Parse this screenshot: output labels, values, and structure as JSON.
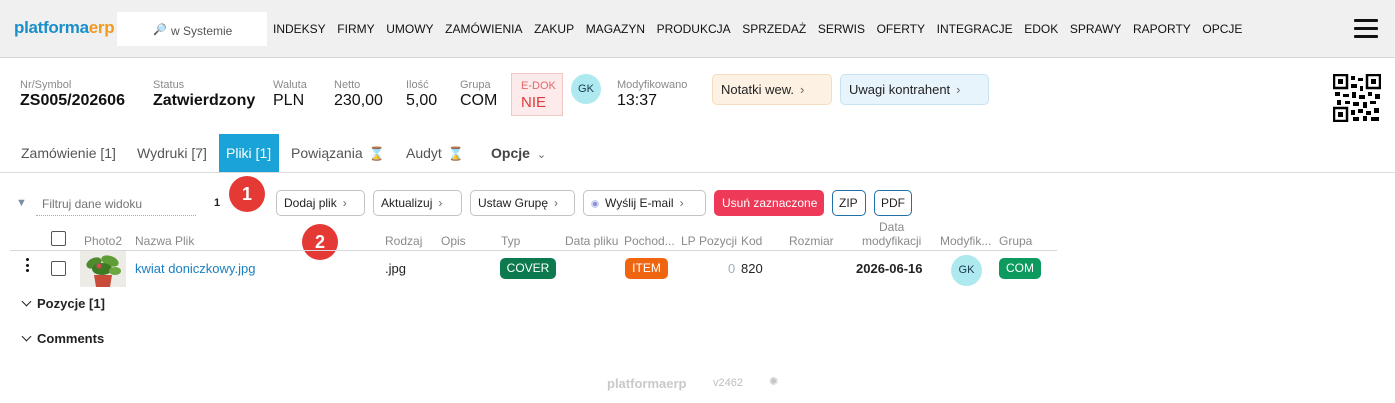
{
  "app": {
    "logo_part1": "platforma",
    "logo_part2": "erp"
  },
  "search": {
    "placeholder": "w Systemie"
  },
  "nav": [
    "INDEKSY",
    "FIRMY",
    "UMOWY",
    "ZAMÓWIENIA",
    "ZAKUP",
    "MAGAZYN",
    "PRODUKCJA",
    "SPRZEDAŻ",
    "SERWIS",
    "OFERTY",
    "INTEGRACJE",
    "EDOK",
    "SPRAWY",
    "RAPORTY",
    "OPCJE"
  ],
  "header": {
    "nr_label": "Nr/Symbol",
    "nr_value": "ZS005/202606",
    "status_label": "Status",
    "status_value": "Zatwierdzony",
    "waluta_label": "Waluta",
    "waluta_value": "PLN",
    "netto_label": "Netto",
    "netto_value": "230,00",
    "ilosc_label": "Ilość",
    "ilosc_value": "5,00",
    "grupa_label": "Grupa",
    "grupa_value": "COM",
    "edok_label": "E-DOK",
    "edok_value": "NIE",
    "user_initials": "GK",
    "modified_label": "Modyfikowano",
    "modified_value": "13:37",
    "notes_label": "Notatki wew.",
    "remarks_label": "Uwagi kontrahent"
  },
  "tabs": [
    {
      "label": "Zamówienie [1]"
    },
    {
      "label": "Wydruki [7]"
    },
    {
      "label": "Pliki [1]",
      "active": true
    },
    {
      "label": "Powiązania"
    },
    {
      "label": "Audyt"
    },
    {
      "label": "Opcje"
    }
  ],
  "toolbar": {
    "filter_placeholder": "Filtruj dane widoku",
    "count": "1",
    "add_file": "Dodaj plik",
    "refresh": "Aktualizuj",
    "set_group": "Ustaw Grupę",
    "send_email": "Wyślij E-mail",
    "delete_selected": "Usuń zaznaczone",
    "zip": "ZIP",
    "pdf": "PDF"
  },
  "annotations": [
    "1",
    "2"
  ],
  "table": {
    "columns": {
      "photo": "Photo2",
      "name": "Nazwa Plik",
      "type": "Rodzaj",
      "desc": "Opis",
      "typ": "Typ",
      "file_date": "Data pliku",
      "origin": "Pochod...",
      "lp": "LP",
      "position": "Pozycji",
      "code": "Kod",
      "size": "Rozmiar",
      "mod_date_1": "Data",
      "mod_date_2": "modyfikacji",
      "modifier": "Modyfik...",
      "group": "Grupa"
    },
    "rows": [
      {
        "name": "kwiat doniczkowy.jpg",
        "type": ".jpg",
        "typ": "COVER",
        "origin": "ITEM",
        "position": "0",
        "code": "820",
        "mod_date": "2026-06-16",
        "modifier": "GK",
        "group": "COM"
      }
    ]
  },
  "sections": [
    "Pozycje [1]",
    "Comments"
  ],
  "footer": {
    "logo_part1": "platforma",
    "logo_part2": "erp",
    "version": "v2462"
  },
  "colors": {
    "accent": "#1aa3d6",
    "danger": "#ee3a58",
    "cover": "#0c7a4e",
    "item": "#f0650f",
    "group": "#0c9a5e"
  }
}
